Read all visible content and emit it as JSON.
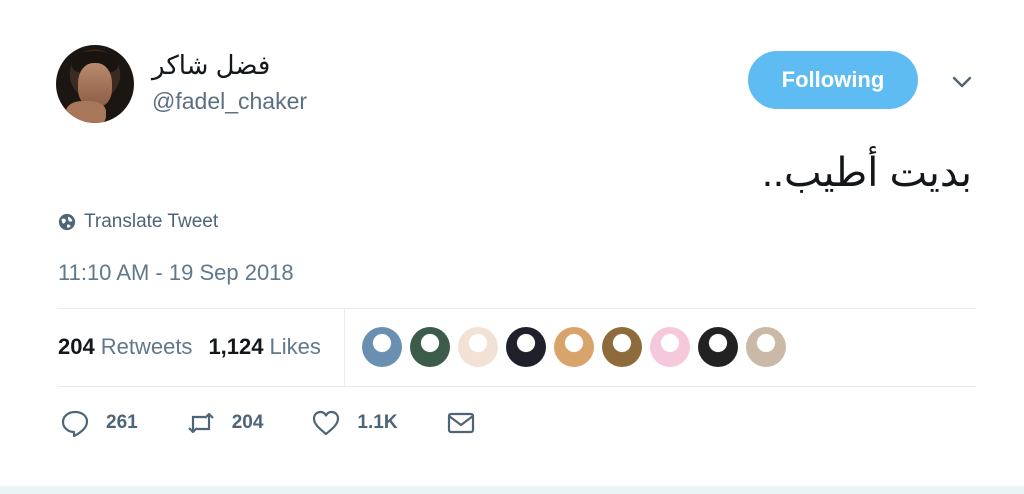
{
  "author": {
    "display_name": "فضل شاكر",
    "handle": "@fadel_chaker"
  },
  "follow_button": {
    "label": "Following"
  },
  "tweet": {
    "text": "بديت أطيب.."
  },
  "translate": {
    "label": "Translate Tweet"
  },
  "timestamp": "11:10 AM - 19 Sep 2018",
  "stats": {
    "retweets_count": "204",
    "retweets_label": "Retweets",
    "likes_count": "1,124",
    "likes_label": "Likes"
  },
  "actions": {
    "reply_count": "261",
    "retweet_count": "204",
    "like_count": "1.1K"
  },
  "colors": {
    "accent": "#5fbcf2",
    "muted_text": "#60788a",
    "divider": "#e6ecf0"
  },
  "likers": [
    {
      "bg": "#6a8fb0"
    },
    {
      "bg": "#3d5b4a"
    },
    {
      "bg": "#f2e2d6"
    },
    {
      "bg": "#20202a"
    },
    {
      "bg": "#d9a46c"
    },
    {
      "bg": "#8d6b3a"
    },
    {
      "bg": "#f5c8dc"
    },
    {
      "bg": "#222222"
    },
    {
      "bg": "#cbb9a8"
    }
  ]
}
